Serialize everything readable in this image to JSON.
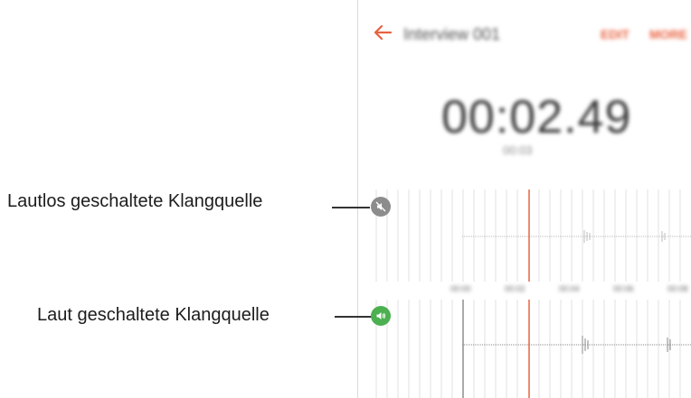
{
  "callouts": {
    "muted_source": "Lautlos geschaltete Klangquelle",
    "loud_source": "Laut geschaltete Klangquelle"
  },
  "appbar": {
    "title": "Interview 001",
    "edit_label": "EDIT",
    "more_label": "MORE",
    "accent_color": "#e8623f"
  },
  "player": {
    "elapsed": "00:02.49",
    "total": "00:03"
  },
  "timeline": {
    "ticks": [
      "00:00",
      "00:02",
      "00:04",
      "00:06",
      "00:08"
    ]
  },
  "icons": {
    "back": "arrow-left-icon",
    "muted": "speaker-muted-icon",
    "loud": "speaker-on-icon"
  },
  "colors": {
    "muted_button": "#8c8c8c",
    "loud_button": "#4caf50",
    "playhead": "#e8623f"
  }
}
